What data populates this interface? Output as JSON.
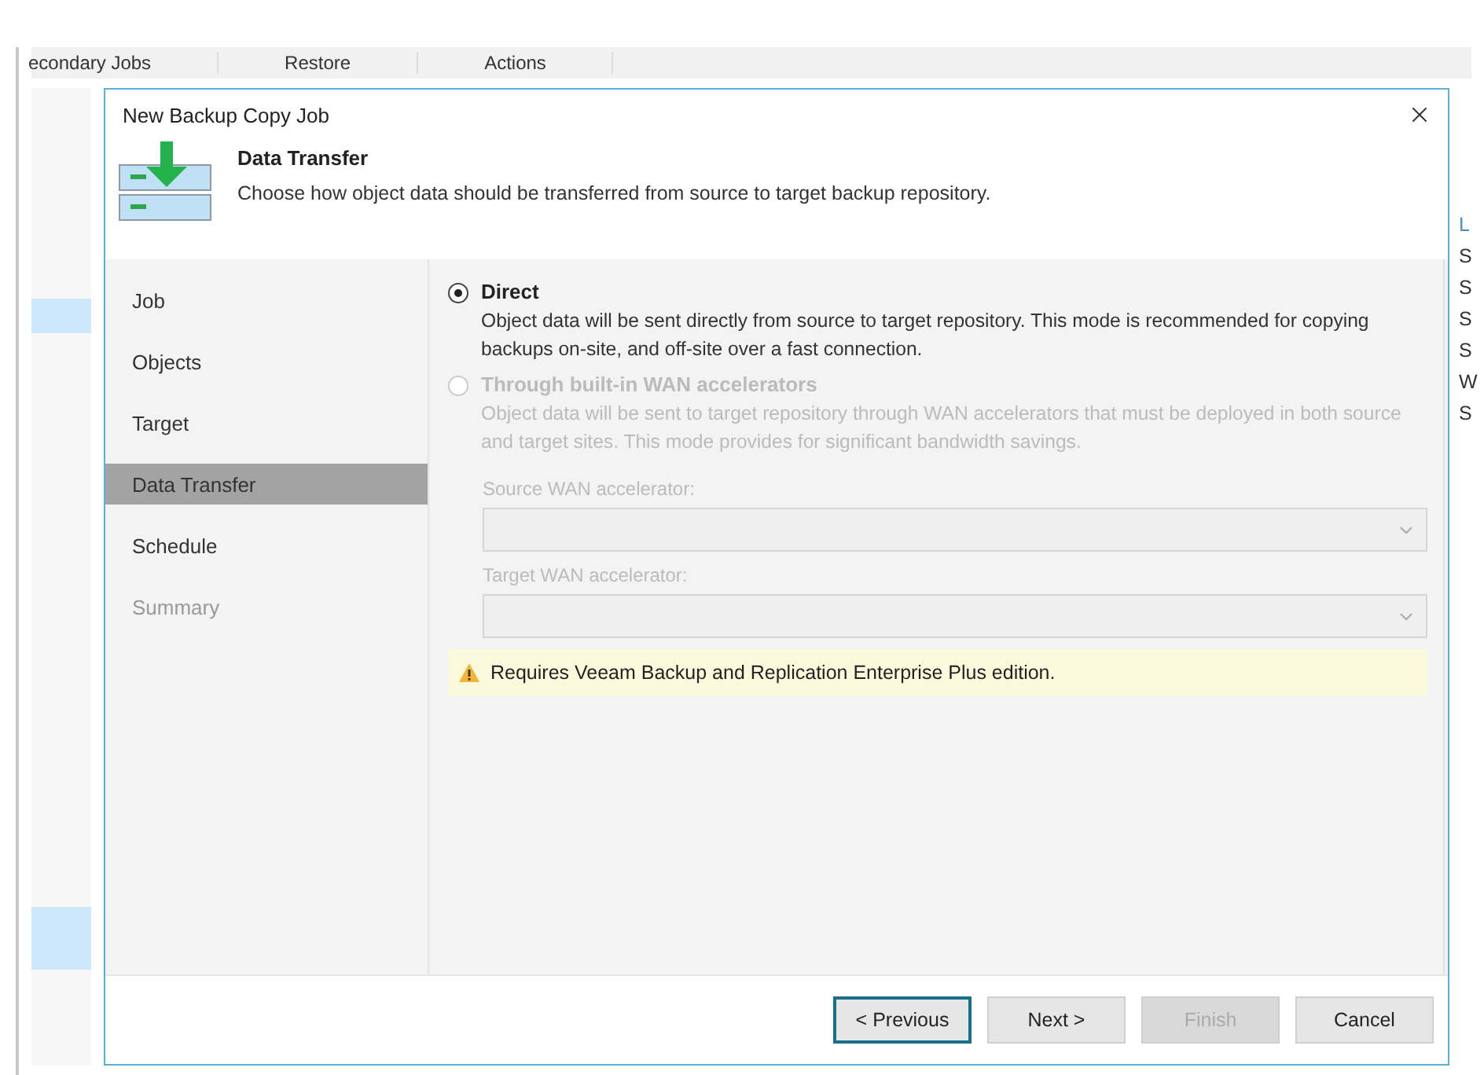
{
  "background": {
    "tabs": [
      {
        "label": "econdary Jobs"
      },
      {
        "label": "Restore"
      },
      {
        "label": "Actions"
      }
    ],
    "right_column": [
      {
        "text": "L",
        "kind": "header"
      },
      {
        "text": "S",
        "kind": "cell"
      },
      {
        "text": "S",
        "kind": "cell"
      },
      {
        "text": "S",
        "kind": "cell"
      },
      {
        "text": "S",
        "kind": "cell"
      },
      {
        "text": "W",
        "kind": "cell"
      },
      {
        "text": "S",
        "kind": "cell"
      }
    ]
  },
  "dialog": {
    "title": "New Backup Copy Job",
    "header": {
      "title": "Data Transfer",
      "description": "Choose how object data should be transferred from source to target backup repository."
    },
    "steps": [
      {
        "label": "Job",
        "selected": false,
        "disabled": false
      },
      {
        "label": "Objects",
        "selected": false,
        "disabled": false
      },
      {
        "label": "Target",
        "selected": false,
        "disabled": false
      },
      {
        "label": "Data Transfer",
        "selected": true,
        "disabled": false
      },
      {
        "label": "Schedule",
        "selected": false,
        "disabled": false
      },
      {
        "label": "Summary",
        "selected": false,
        "disabled": true
      }
    ],
    "options": [
      {
        "label": "Direct",
        "description": "Object data will be sent directly from source to target repository. This mode is recommended for copying backups on-site, and off-site over a fast connection.",
        "selected": true,
        "disabled": false
      },
      {
        "label": "Through built-in WAN accelerators",
        "description": "Object data will be sent to target repository through WAN accelerators that must be deployed in both source and target sites. This mode provides for significant bandwidth savings.",
        "selected": false,
        "disabled": true
      }
    ],
    "fields": [
      {
        "label": "Source WAN accelerator:",
        "disabled": true
      },
      {
        "label": "Target WAN accelerator:",
        "disabled": true
      }
    ],
    "warning": {
      "text": "Requires Veeam Backup and Replication Enterprise Plus edition."
    },
    "buttons": [
      {
        "label": "< Previous",
        "focused": true,
        "disabled": false
      },
      {
        "label": "Next >",
        "focused": false,
        "disabled": false
      },
      {
        "label": "Finish",
        "focused": false,
        "disabled": true
      },
      {
        "label": "Cancel",
        "focused": false,
        "disabled": false
      }
    ]
  }
}
